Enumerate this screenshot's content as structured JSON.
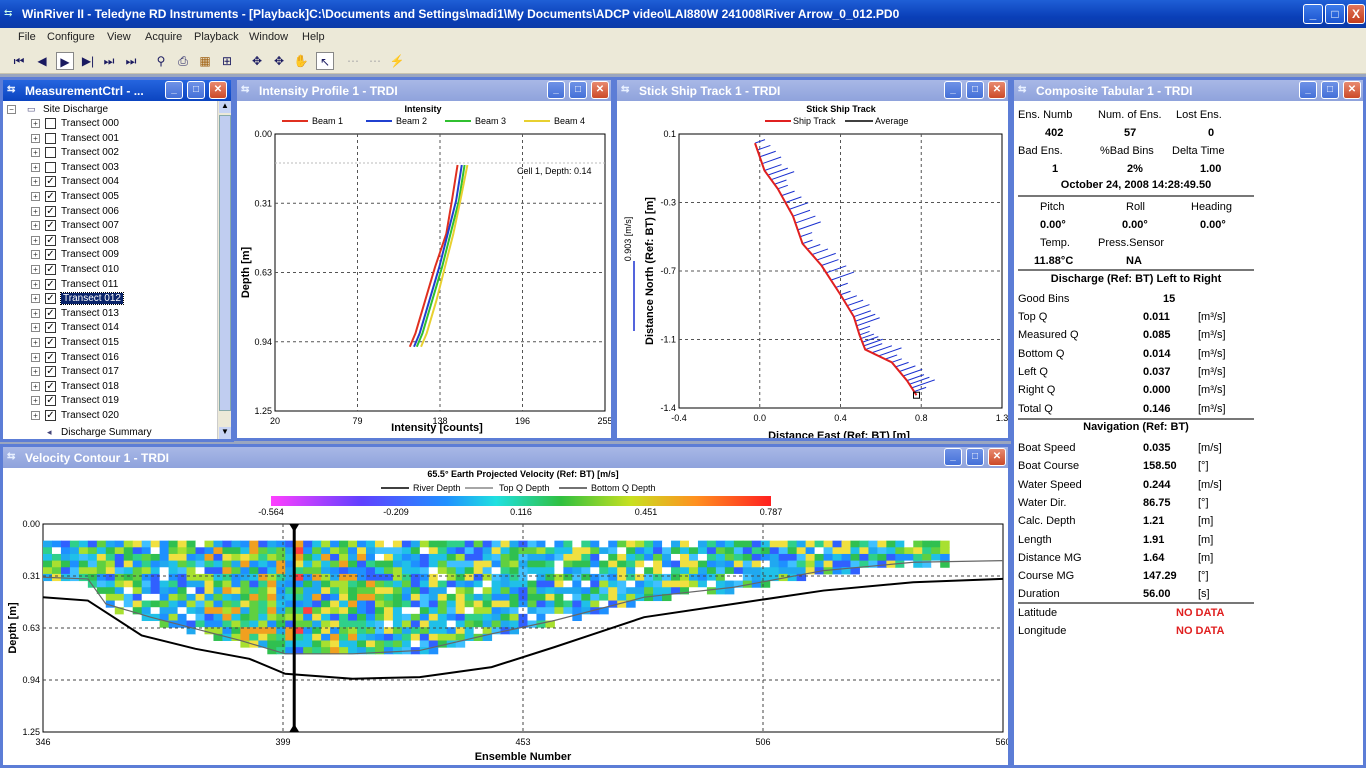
{
  "app": {
    "title": "WinRiver II - Teledyne RD Instruments - [Playback]C:\\Documents and Settings\\madi1\\My Documents\\ADCP video\\LAI880W 241008\\River Arrow_0_012.PD0",
    "window_buttons": [
      "_",
      "□",
      "X"
    ]
  },
  "menu": [
    "File",
    "Configure",
    "View",
    "Acquire",
    "Playback",
    "Window",
    "Help"
  ],
  "toolbar_icons": [
    "first-icon",
    "prev-icon",
    "play-icon",
    "next-icon",
    "step-icon",
    "last-icon",
    "zoom-icon",
    "export-icon",
    "chart-icon",
    "grid-icon",
    "pan-icon",
    "pan2-icon",
    "hand-icon",
    "pointer-icon",
    "disabled1-icon",
    "disabled2-icon",
    "lightning-icon"
  ],
  "measurement": {
    "title": "MeasurementCtrl - ...",
    "root": "Site Discharge",
    "items": [
      {
        "label": "Transect 000",
        "checked": false
      },
      {
        "label": "Transect 001",
        "checked": false
      },
      {
        "label": "Transect 002",
        "checked": false
      },
      {
        "label": "Transect 003",
        "checked": false
      },
      {
        "label": "Transect 004",
        "checked": true
      },
      {
        "label": "Transect 005",
        "checked": true
      },
      {
        "label": "Transect 006",
        "checked": true
      },
      {
        "label": "Transect 007",
        "checked": true
      },
      {
        "label": "Transect 008",
        "checked": true
      },
      {
        "label": "Transect 009",
        "checked": true
      },
      {
        "label": "Transect 010",
        "checked": true
      },
      {
        "label": "Transect 011",
        "checked": true
      },
      {
        "label": "Transect 012",
        "checked": true
      },
      {
        "label": "Transect 013",
        "checked": true
      },
      {
        "label": "Transect 014",
        "checked": true
      },
      {
        "label": "Transect 015",
        "checked": true
      },
      {
        "label": "Transect 016",
        "checked": true
      },
      {
        "label": "Transect 017",
        "checked": true
      },
      {
        "label": "Transect 018",
        "checked": true
      },
      {
        "label": "Transect 019",
        "checked": true
      },
      {
        "label": "Transect 020",
        "checked": true
      }
    ],
    "selected": "Transect 012",
    "summary": "Discharge Summary"
  },
  "intensity": {
    "title": "Intensity Profile 1 - TRDI",
    "annotation": "Cell 1, Depth: 0.14"
  },
  "shiptrack": {
    "title": "Stick Ship Track 1 - TRDI",
    "scale_label": "0.903 [m/s]"
  },
  "contour": {
    "title": "Velocity Contour 1 - TRDI",
    "colorbar_ticks": [
      "-0.564",
      "-0.209",
      "0.116",
      "0.451",
      "0.787"
    ]
  },
  "composite": {
    "title": "Composite Tabular 1 - TRDI",
    "top": {
      "h1": [
        "Ens. Numb",
        "Num. of Ens.",
        "Lost Ens."
      ],
      "v1": [
        "402",
        "57",
        "0"
      ],
      "h2": [
        "Bad Ens.",
        "%Bad Bins",
        "Delta Time"
      ],
      "v2": [
        "1",
        "2%",
        "1.00"
      ],
      "datetime": "October 24, 2008  14:28:49.50",
      "h3": [
        "Pitch",
        "Roll",
        "Heading"
      ],
      "v3": [
        "0.00°",
        "0.00°",
        "0.00°"
      ],
      "h4": [
        "Temp.",
        "Press.Sensor"
      ],
      "v4": [
        "11.88°C",
        "NA"
      ]
    },
    "discharge_header": "Discharge (Ref: BT) Left to Right",
    "good_bins_label": "Good Bins",
    "good_bins_value": "15",
    "discharge_rows": [
      {
        "label": "Top Q",
        "value": "0.011",
        "unit": "[m³/s]"
      },
      {
        "label": "Measured Q",
        "value": "0.085",
        "unit": "[m³/s]"
      },
      {
        "label": "Bottom Q",
        "value": "0.014",
        "unit": "[m³/s]"
      },
      {
        "label": "Left Q",
        "value": "0.037",
        "unit": "[m³/s]"
      },
      {
        "label": "Right Q",
        "value": "0.000",
        "unit": "[m³/s]"
      },
      {
        "label": "Total Q",
        "value": "0.146",
        "unit": "[m³/s]"
      }
    ],
    "nav_header": "Navigation (Ref: BT)",
    "nav_rows": [
      {
        "label": "Boat Speed",
        "value": "0.035",
        "unit": "[m/s]"
      },
      {
        "label": "Boat Course",
        "value": "158.50",
        "unit": "[°]"
      },
      {
        "label": "Water Speed",
        "value": "0.244",
        "unit": "[m/s]"
      },
      {
        "label": "Water Dir.",
        "value": "86.75",
        "unit": "[°]"
      },
      {
        "label": "Calc. Depth",
        "value": "1.21",
        "unit": "[m]"
      },
      {
        "label": "Length",
        "value": "1.91",
        "unit": "[m]"
      },
      {
        "label": "Distance MG",
        "value": "1.64",
        "unit": "[m]"
      },
      {
        "label": "Course MG",
        "value": "147.29",
        "unit": "[°]"
      },
      {
        "label": "Duration",
        "value": "56.00",
        "unit": "[s]"
      }
    ],
    "lat_label": "Latitude",
    "lon_label": "Longitude",
    "lat_value": "NO DATA",
    "lon_value": "NO DATA"
  },
  "chart_data": [
    {
      "type": "line",
      "title": "Intensity",
      "xlabel": "Intensity [counts]",
      "ylabel": "Depth [m]",
      "xlim": [
        20,
        255
      ],
      "ylim": [
        1.25,
        0.0
      ],
      "x_ticks": [
        "20",
        "79",
        "138",
        "196",
        "255"
      ],
      "y_ticks": [
        "0.00",
        "0.31",
        "0.63",
        "0.94",
        "1.25"
      ],
      "series": [
        {
          "name": "Beam 1",
          "color": "#e03020",
          "points": [
            [
              150,
              0.14
            ],
            [
              146,
              0.3
            ],
            [
              142,
              0.45
            ],
            [
              134,
              0.6
            ],
            [
              127,
              0.75
            ],
            [
              120,
              0.9
            ],
            [
              116,
              0.96
            ]
          ]
        },
        {
          "name": "Beam 2",
          "color": "#2040d0",
          "points": [
            [
              153,
              0.14
            ],
            [
              149,
              0.3
            ],
            [
              143,
              0.45
            ],
            [
              137,
              0.6
            ],
            [
              130,
              0.75
            ],
            [
              123,
              0.9
            ],
            [
              119,
              0.96
            ]
          ]
        },
        {
          "name": "Beam 3",
          "color": "#30c030",
          "points": [
            [
              155,
              0.14
            ],
            [
              151,
              0.3
            ],
            [
              145,
              0.45
            ],
            [
              139,
              0.6
            ],
            [
              132,
              0.75
            ],
            [
              125,
              0.9
            ],
            [
              121,
              0.96
            ]
          ]
        },
        {
          "name": "Beam 4",
          "color": "#e8d030",
          "points": [
            [
              157,
              0.14
            ],
            [
              152,
              0.3
            ],
            [
              147,
              0.45
            ],
            [
              141,
              0.6
            ],
            [
              135,
              0.75
            ],
            [
              128,
              0.9
            ],
            [
              124,
              0.96
            ]
          ]
        }
      ]
    },
    {
      "type": "line",
      "title": "Stick Ship Track",
      "xlabel": "Distance East (Ref: BT) [m]",
      "ylabel": "Distance North (Ref: BT) [m]",
      "xlim": [
        -0.4,
        1.3
      ],
      "ylim": [
        -1.4,
        0.1
      ],
      "x_ticks": [
        "-0.4",
        "0.0",
        "0.4",
        "0.8",
        "1.3"
      ],
      "y_ticks": [
        "0.1",
        "-0.3",
        "-0.7",
        "-1.1",
        "-1.4"
      ],
      "series": [
        {
          "name": "Ship Track",
          "color": "#e02020",
          "points": [
            [
              0.0,
              0.05
            ],
            [
              0.05,
              -0.1
            ],
            [
              0.12,
              -0.2
            ],
            [
              0.2,
              -0.35
            ],
            [
              0.25,
              -0.5
            ],
            [
              0.35,
              -0.62
            ],
            [
              0.45,
              -0.78
            ],
            [
              0.52,
              -0.9
            ],
            [
              0.55,
              -1.0
            ],
            [
              0.58,
              -1.08
            ],
            [
              0.72,
              -1.15
            ],
            [
              0.8,
              -1.25
            ],
            [
              0.85,
              -1.33
            ]
          ]
        },
        {
          "name": "Average",
          "color": "#000000",
          "points": []
        }
      ]
    },
    {
      "type": "heatmap",
      "title": "65.5° Earth Projected Velocity (Ref: BT) [m/s]",
      "xlabel": "Ensemble Number",
      "ylabel": "Depth [m]",
      "xlim": [
        346,
        560
      ],
      "ylim": [
        1.25,
        0.0
      ],
      "x_ticks": [
        "346",
        "399",
        "453",
        "506",
        "560"
      ],
      "y_ticks": [
        "0.00",
        "0.31",
        "0.63",
        "0.94",
        "1.25"
      ],
      "legend": [
        "River Depth",
        "Top Q Depth",
        "Bottom Q Depth"
      ],
      "colorbar": {
        "min": -0.564,
        "max": 0.787
      },
      "cursor_ensemble": 402,
      "river_depth": [
        [
          346,
          0.44
        ],
        [
          356,
          0.46
        ],
        [
          368,
          0.67
        ],
        [
          380,
          0.75
        ],
        [
          392,
          0.81
        ],
        [
          400,
          0.9
        ],
        [
          415,
          0.93
        ],
        [
          430,
          0.92
        ],
        [
          446,
          0.86
        ],
        [
          460,
          0.74
        ],
        [
          480,
          0.56
        ],
        [
          500,
          0.48
        ],
        [
          520,
          0.4
        ],
        [
          540,
          0.35
        ],
        [
          560,
          0.33
        ]
      ],
      "bottom_q_depth": [
        [
          346,
          0.32
        ],
        [
          356,
          0.33
        ],
        [
          360,
          0.48
        ],
        [
          370,
          0.56
        ],
        [
          380,
          0.63
        ],
        [
          390,
          0.7
        ],
        [
          400,
          0.78
        ],
        [
          415,
          0.78
        ],
        [
          430,
          0.76
        ],
        [
          446,
          0.66
        ],
        [
          460,
          0.58
        ],
        [
          480,
          0.44
        ],
        [
          500,
          0.38
        ],
        [
          520,
          0.28
        ],
        [
          540,
          0.23
        ],
        [
          560,
          0.22
        ]
      ]
    }
  ]
}
